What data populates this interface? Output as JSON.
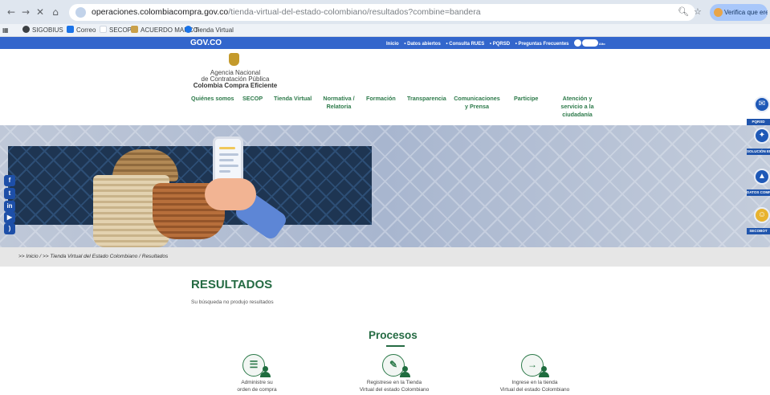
{
  "browser": {
    "url_host": "operaciones.colombiacompra.gov.co",
    "url_path": "/tienda-virtual-del-estado-colombiano/resultados?combine=bandera",
    "profile_button": "Verifica que eres tú",
    "bookmarks": [
      "SIGOBIUS",
      "Correo",
      "SECOP",
      "ACUERDO MARCO",
      "Tienda Virtual"
    ]
  },
  "govbar": {
    "logo": "GOV.CO",
    "links": [
      "Inicio",
      "• Datos abiertos",
      "• Consulta RUES",
      "• PQRSD",
      "• Preguntas Frecuentes"
    ],
    "language": "EN",
    "accessibility": "Alto"
  },
  "agency": {
    "line1": "Agencia Nacional",
    "line2": "de Contratación Pública",
    "line3": "Colombia Compra Eficiente"
  },
  "nav": {
    "items": [
      "Quiénes somos",
      "SECOP",
      "Tienda Virtual",
      "Normativa / Relatoria",
      "Formación",
      "Transparencia",
      "Comunicaciones y Prensa",
      "Participe",
      "Atención y servicio a la ciudadanía"
    ]
  },
  "side_tools": [
    "PQRSD",
    "SOLUCIÓN EN LÍNEA",
    "DATOS COMPRA PÚBLICA",
    "SECOBOT"
  ],
  "breadcrumb": ">> Inicio / >> Tienda Virtual del Estado Colombiano / Resultados",
  "results": {
    "title": "RESULTADOS",
    "message": "Su búsqueda no produjo resultados"
  },
  "procesos": {
    "title": "Procesos",
    "items": [
      {
        "line1": "Administre su",
        "line2": "orden de compra",
        "icon": "checklist-icon"
      },
      {
        "line1": "Registrese en la Tienda",
        "line2": "Virtual del estado Colombiano",
        "icon": "pencil-icon"
      },
      {
        "line1": "Ingrese en la tienda",
        "line2": "Virtual del estado Colombiano",
        "icon": "login-arrow-icon"
      }
    ]
  }
}
